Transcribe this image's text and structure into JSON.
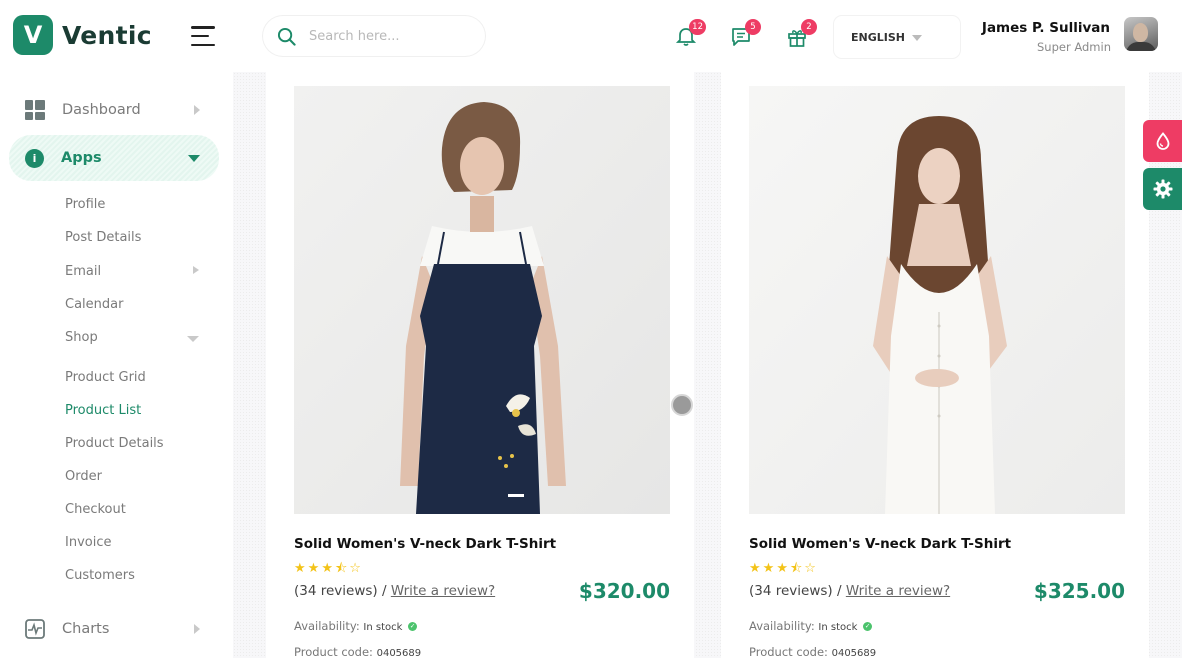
{
  "brand": {
    "logo_letter": "V",
    "name": "Ventic",
    "accent": "#1d8a69"
  },
  "header": {
    "search_placeholder": "Search here...",
    "notifications": {
      "icon": "bell-icon",
      "count": "12"
    },
    "messages": {
      "icon": "chat-icon",
      "count": "5"
    },
    "gifts": {
      "icon": "gift-icon",
      "count": "2"
    },
    "language": "ENGLISH",
    "user": {
      "name": "James P. Sullivan",
      "role": "Super Admin"
    }
  },
  "sidebar": {
    "items": [
      {
        "label": "Dashboard",
        "icon": "dashboard-grid-icon"
      },
      {
        "label": "Apps",
        "icon": "info-icon",
        "icon_glyph": "i"
      },
      {
        "label": "Charts",
        "icon": "pulse-chart-icon"
      }
    ],
    "apps_sub": [
      {
        "label": "Profile"
      },
      {
        "label": "Post Details"
      },
      {
        "label": "Email"
      },
      {
        "label": "Calendar"
      },
      {
        "label": "Shop"
      }
    ],
    "shop_sub": [
      {
        "label": "Product Grid"
      },
      {
        "label": "Product List"
      },
      {
        "label": "Product Details"
      },
      {
        "label": "Order"
      },
      {
        "label": "Checkout"
      },
      {
        "label": "Invoice"
      },
      {
        "label": "Customers"
      }
    ]
  },
  "products": [
    {
      "title": "Solid Women's V-neck Dark T-Shirt",
      "rating": 3.5,
      "reviews": "(34 reviews)",
      "separator": "/",
      "write_review": "Write a review?",
      "price": "$320.00",
      "availability_label": "Availability:",
      "availability_value": "In stock",
      "code_label": "Product code:",
      "code_value": "0405689"
    },
    {
      "title": "Solid Women's V-neck Dark T-Shirt",
      "rating": 3.5,
      "reviews": "(34 reviews)",
      "separator": "/",
      "write_review": "Write a review?",
      "price": "$325.00",
      "availability_label": "Availability:",
      "availability_value": "In stock",
      "code_label": "Product code:",
      "code_value": "0405689"
    }
  ],
  "floating": {
    "theme_icon": "droplet-icon",
    "settings_icon": "gear-icon"
  },
  "colors": {
    "price": "#1d8a69",
    "badge": "#ee3c64",
    "star": "#f3c318"
  }
}
